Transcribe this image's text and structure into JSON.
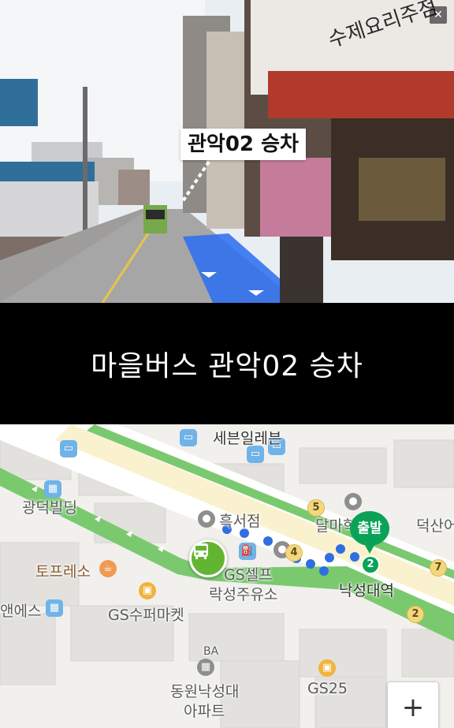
{
  "street_view": {
    "label": "관악02 승차",
    "close_icon": "close-icon"
  },
  "caption": {
    "text": "마을버스 관악02 승차"
  },
  "map": {
    "places": [
      {
        "key": "sebeun",
        "text": "세븐일레븐"
      },
      {
        "key": "gwangdeok",
        "text": "광덕빌딩"
      },
      {
        "key": "heukseo",
        "text": "흑서점"
      },
      {
        "key": "dalmak",
        "text": "달마학"
      },
      {
        "key": "deoksan",
        "text": "덕산어"
      },
      {
        "key": "toprs",
        "text": "토프레소"
      },
      {
        "key": "gsself",
        "text": "GS셀프"
      },
      {
        "key": "nakseong_oil",
        "text": "락성주유소"
      },
      {
        "key": "nakseongdae_station",
        "text": "낙성대역"
      },
      {
        "key": "anes",
        "text": "앤에스"
      },
      {
        "key": "gs_super",
        "text": "GS수퍼마켓"
      },
      {
        "key": "dongwon",
        "text": "동원낙성대"
      },
      {
        "key": "apt",
        "text": "아파트"
      },
      {
        "key": "gs25",
        "text": "GS25"
      },
      {
        "key": "ba",
        "text": "BA"
      }
    ],
    "route_numbers": [
      "5",
      "4",
      "7",
      "2"
    ],
    "start_marker": "출발",
    "start_badge": "2",
    "zoom_in_label": "+"
  },
  "colors": {
    "route_blue": "#2f6fe0",
    "bus_green": "#62b531",
    "start_green": "#0aa257",
    "road_green": "#7bc96f"
  }
}
